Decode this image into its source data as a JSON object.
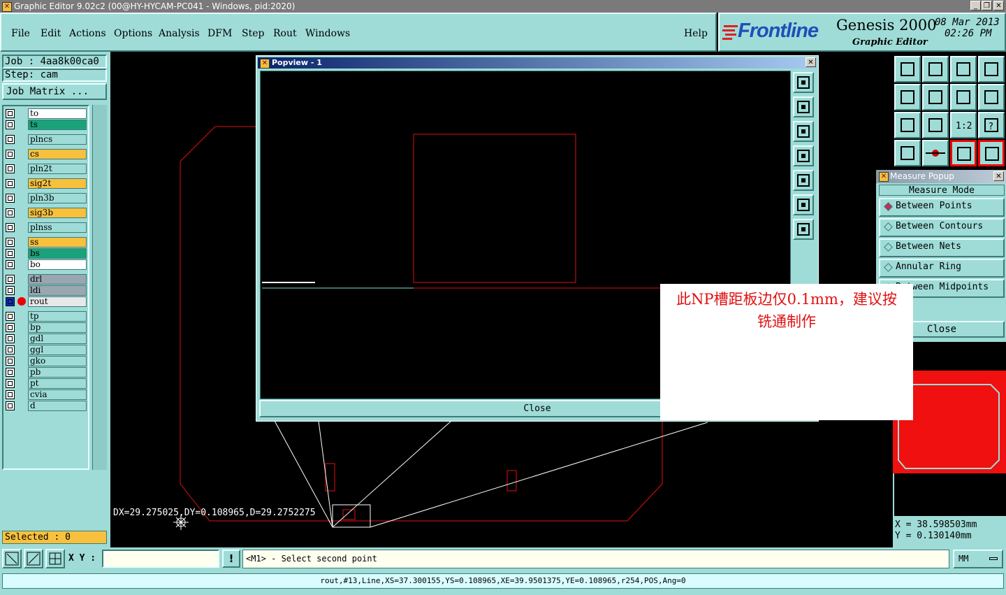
{
  "window": {
    "title": "Graphic Editor 9.02c2 (00@HY-HYCAM-PC041 - Windows, pid:2020)"
  },
  "menu": {
    "items": [
      "File",
      "Edit",
      "Actions",
      "Options",
      "Analysis",
      "DFM",
      "Step",
      "Rout",
      "Windows"
    ],
    "help": "Help"
  },
  "logo": {
    "brand": "Frontline",
    "product": "Genesis 2000",
    "subtitle": "Graphic Editor",
    "date": "08 Mar 2013",
    "time": "02:26 PM"
  },
  "job": {
    "job_label": "Job : 4aa8k00ca0",
    "step_label": "Step: cam",
    "matrix_button": "Job Matrix ..."
  },
  "layers": [
    {
      "name": "to",
      "color": "#ffffff"
    },
    {
      "name": "ts",
      "color": "#1aa37a"
    },
    {
      "name": "plncs",
      "color": "#9fdcd7"
    },
    {
      "name": "cs",
      "color": "#f7c13d"
    },
    {
      "name": "pln2t",
      "color": "#9fdcd7"
    },
    {
      "name": "sig2t",
      "color": "#f7c13d"
    },
    {
      "name": "pln3b",
      "color": "#9fdcd7"
    },
    {
      "name": "sig3b",
      "color": "#f7c13d"
    },
    {
      "name": "plnss",
      "color": "#9fdcd7"
    },
    {
      "name": "ss",
      "color": "#f7c13d"
    },
    {
      "name": "bs",
      "color": "#1aa37a"
    },
    {
      "name": "bo",
      "color": "#ffffff"
    },
    {
      "name": "drl",
      "color": "#9aa7b2"
    },
    {
      "name": "ldi",
      "color": "#9aa7b2"
    },
    {
      "name": "rout",
      "color": "#e8e8e8"
    },
    {
      "name": "tp",
      "color": "#9fdcd7"
    },
    {
      "name": "bp",
      "color": "#9fdcd7"
    },
    {
      "name": "gdl",
      "color": "#9fdcd7"
    },
    {
      "name": "ggl",
      "color": "#9fdcd7"
    },
    {
      "name": "gko",
      "color": "#9fdcd7"
    },
    {
      "name": "pb",
      "color": "#9fdcd7"
    },
    {
      "name": "pt",
      "color": "#9fdcd7"
    },
    {
      "name": "cvia",
      "color": "#9fdcd7"
    },
    {
      "name": "d",
      "color": "#9fdcd7"
    }
  ],
  "selected_label": "Selected : 0",
  "canvas": {
    "measure_text": "DX=29.275025,DY=0.108965,D=29.2752275"
  },
  "popview": {
    "title": "Popview - 1",
    "close": "Close"
  },
  "measure_popup": {
    "title": "Measure Popup",
    "header": "Measure Mode",
    "modes": [
      "Between Points",
      "Between Contours",
      "Between Nets",
      "Annular Ring",
      "Between Midpoints"
    ],
    "selected_mode": "Between Points",
    "close": "Close"
  },
  "coords": {
    "x": "X = 38.598503mm",
    "y": "Y = 0.130140mm"
  },
  "note": {
    "line1": "此NP槽距板边仅0.1mm，建议按",
    "line2": "铣通制作"
  },
  "cmdbar": {
    "xy_label": "X Y :",
    "xy_value": "",
    "prompt": "<M1> - Select second point",
    "unit": "MM"
  },
  "status": "rout,#13,Line,XS=37.300155,YS=0.108965,XE=39.9501375,YE=0.108965,r254,POS,Ang=0"
}
